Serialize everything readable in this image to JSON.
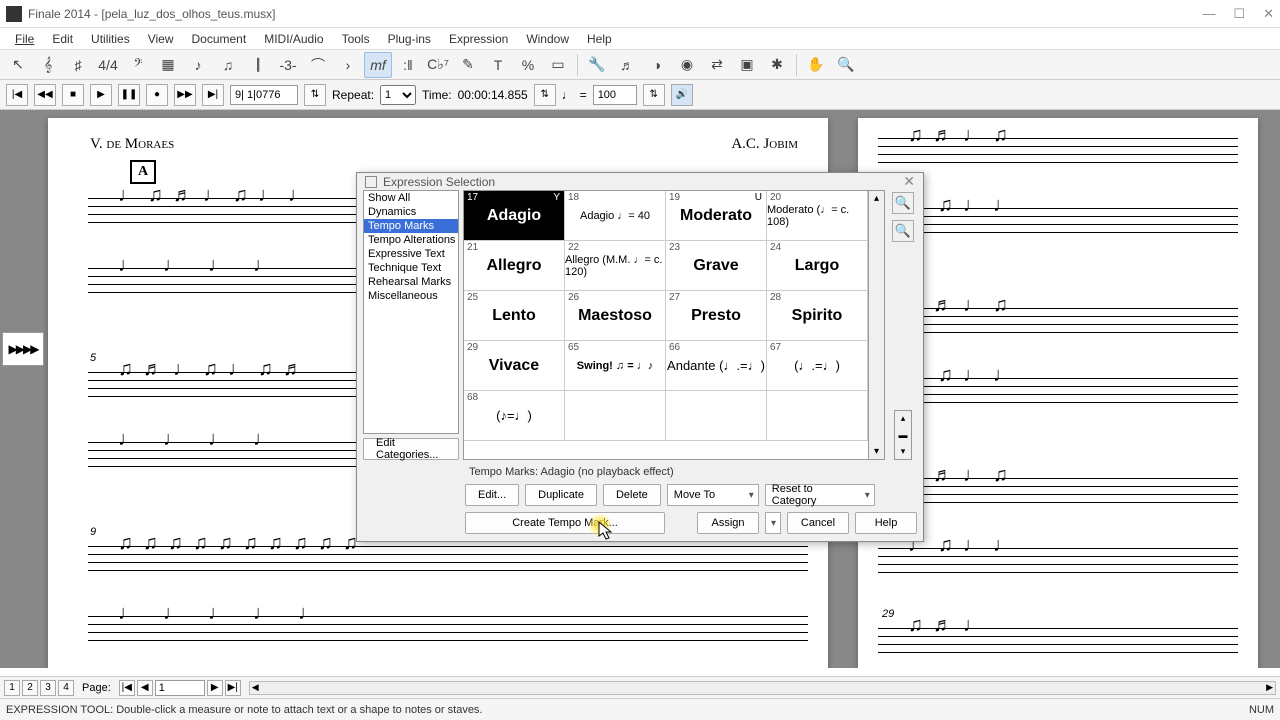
{
  "window": {
    "title": "Finale 2014 - [pela_luz_dos_olhos_teus.musx]"
  },
  "menus": [
    "File",
    "Edit",
    "Utilities",
    "View",
    "Document",
    "MIDI/Audio",
    "Tools",
    "Plug-ins",
    "Expression",
    "Window",
    "Help"
  ],
  "playback": {
    "measure": "9| 1|0776",
    "repeat_label": "Repeat:",
    "repeat_value": "1",
    "time_label": "Time:",
    "time_value": "00:00:14.855",
    "tempo_value": "100"
  },
  "score": {
    "composer_left": "V. de Moraes",
    "composer_right": "A.C. Jobim",
    "rehearsal_letter": "A",
    "measure5": "5",
    "measure9": "9",
    "measure29": "29"
  },
  "dialog": {
    "title": "Expression Selection",
    "categories": [
      "Show All",
      "Dynamics",
      "Tempo Marks",
      "Tempo Alterations",
      "Expressive Text",
      "Technique Text",
      "Rehearsal Marks",
      "Miscellaneous"
    ],
    "selected_category_index": 2,
    "cells": [
      {
        "num": "17",
        "label": "Adagio",
        "selected": true,
        "letter": "Y"
      },
      {
        "num": "18",
        "label": "Adagio ♩= 40",
        "small": true
      },
      {
        "num": "19",
        "label": "Moderato",
        "letter": "U"
      },
      {
        "num": "20",
        "label": "Moderato (♩= c. 108)",
        "small": true
      },
      {
        "num": "21",
        "label": "Allegro"
      },
      {
        "num": "22",
        "label": "Allegro (M.M. ♩= c. 120)",
        "small": true
      },
      {
        "num": "23",
        "label": "Grave"
      },
      {
        "num": "24",
        "label": "Largo"
      },
      {
        "num": "25",
        "label": "Lento"
      },
      {
        "num": "26",
        "label": "Maestoso"
      },
      {
        "num": "27",
        "label": "Presto"
      },
      {
        "num": "28",
        "label": "Spirito"
      },
      {
        "num": "29",
        "label": "Vivace"
      },
      {
        "num": "65",
        "label": "Swing! ♫ = ♩♪",
        "swing": true
      },
      {
        "num": "66",
        "label": "Andante (♩.=♩)",
        "notation": true
      },
      {
        "num": "67",
        "label": "(♩.=♩)",
        "notation": true
      },
      {
        "num": "68",
        "label": "(♪=♩)",
        "notation": true
      }
    ],
    "status": "Tempo Marks: Adagio (no playback effect)",
    "edit_categories": "Edit Categories...",
    "edit": "Edit...",
    "duplicate": "Duplicate",
    "delete": "Delete",
    "move_to": "Move To",
    "reset": "Reset to Category",
    "create": "Create Tempo Mark...",
    "assign": "Assign",
    "cancel": "Cancel",
    "help": "Help"
  },
  "pagebar": {
    "tabs": [
      "1",
      "2",
      "3",
      "4"
    ],
    "label": "Page:",
    "value": "1"
  },
  "statusbar": {
    "text": "EXPRESSION TOOL: Double-click a measure or note to attach text or a shape to notes or staves.",
    "num": "NUM"
  }
}
